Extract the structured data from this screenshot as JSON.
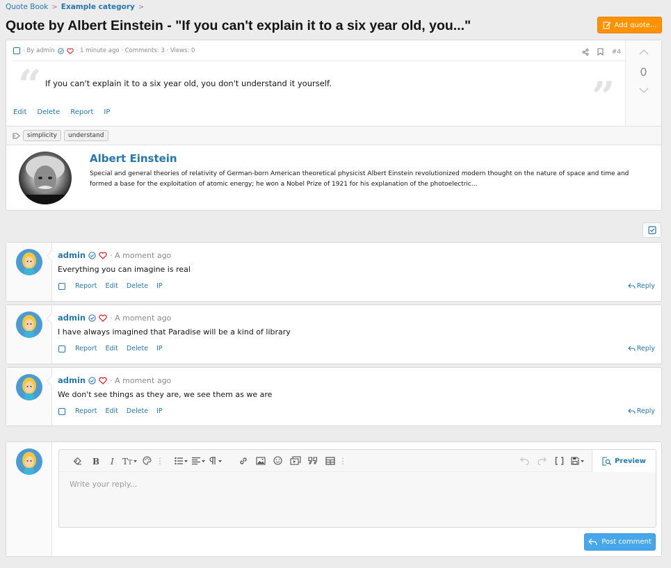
{
  "breadcrumb": [
    {
      "label": "Quote Book",
      "bold": false
    },
    {
      "label": "Example category",
      "bold": true
    }
  ],
  "breadcrumb_separator": ">",
  "page_title": "Quote by Albert Einstein - \"If you can't explain it to a six year old, you...\"",
  "add_quote_label": "Add quote...",
  "quote": {
    "meta_by": "· By admin",
    "meta_time": "· 1 minute ago · Comments: 3 · Views: 0",
    "number": "#4",
    "text": "If you can't explain it to a six year old, you don't understand it yourself.",
    "actions": [
      "Edit",
      "Delete",
      "Report",
      "IP"
    ],
    "score": "0",
    "tags": [
      "simplicity",
      "understand"
    ]
  },
  "author": {
    "name": "Albert Einstein",
    "bio": "Special and general theories of relativity of German-born American theoretical physicist Albert Einstein revolutionized modern thought on the nature of space and time and formed a base for the exploitation of atomic energy; he won a Nobel Prize of 1921 for his explanation of the photoelectric..."
  },
  "comments": [
    {
      "user": "admin",
      "time": "· A moment ago",
      "text": "Everything you can imagine is real"
    },
    {
      "user": "admin",
      "time": "· A moment ago",
      "text": "I have always imagined that Paradise will be a kind of library"
    },
    {
      "user": "admin",
      "time": "· A moment ago",
      "text": "We don't see things as they are, we see them as we are"
    }
  ],
  "comment_actions": [
    "Report",
    "Edit",
    "Delete",
    "IP"
  ],
  "reply_label": "Reply",
  "editor": {
    "placeholder": "Write your reply...",
    "preview_label": "Preview",
    "post_label": "Post comment"
  },
  "colors": {
    "accent": "#2577b1",
    "add_button": "#fe9200",
    "post_button": "#47a7eb",
    "heart": "#e0272f"
  }
}
